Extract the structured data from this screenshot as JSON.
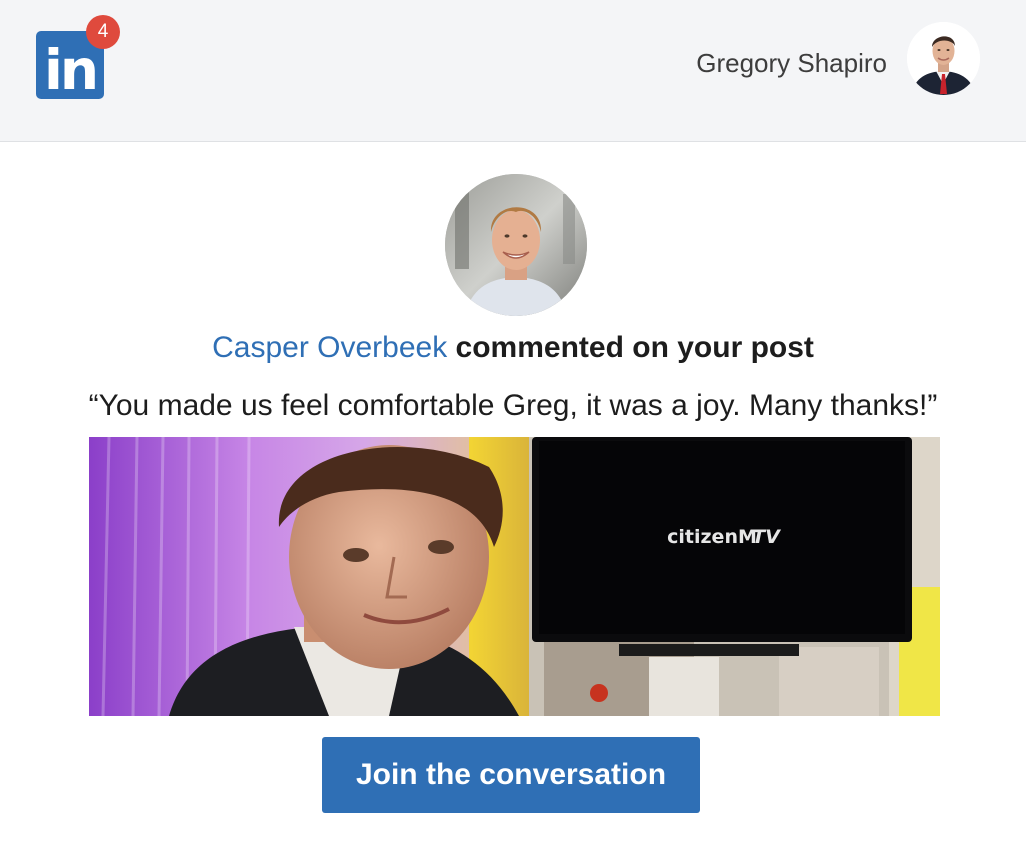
{
  "header": {
    "logo_text": "in",
    "notification_count": "4",
    "user_name": "Gregory Shapiro"
  },
  "notification": {
    "actor_name": "Casper Overbeek",
    "action_text": "commented on your post",
    "comment": "“You made us feel comfortable Greg, it was a joy. Many thanks!”",
    "post_image_tv_text": "citizenM",
    "post_image_tv_text_italic": "TV"
  },
  "cta": {
    "label": "Join the conversation"
  },
  "colors": {
    "brand_blue": "#2f6fb5",
    "badge_red": "#df4a3d",
    "header_bg": "#f4f5f7"
  },
  "icons": {
    "logo": "linkedin-logo-icon"
  }
}
